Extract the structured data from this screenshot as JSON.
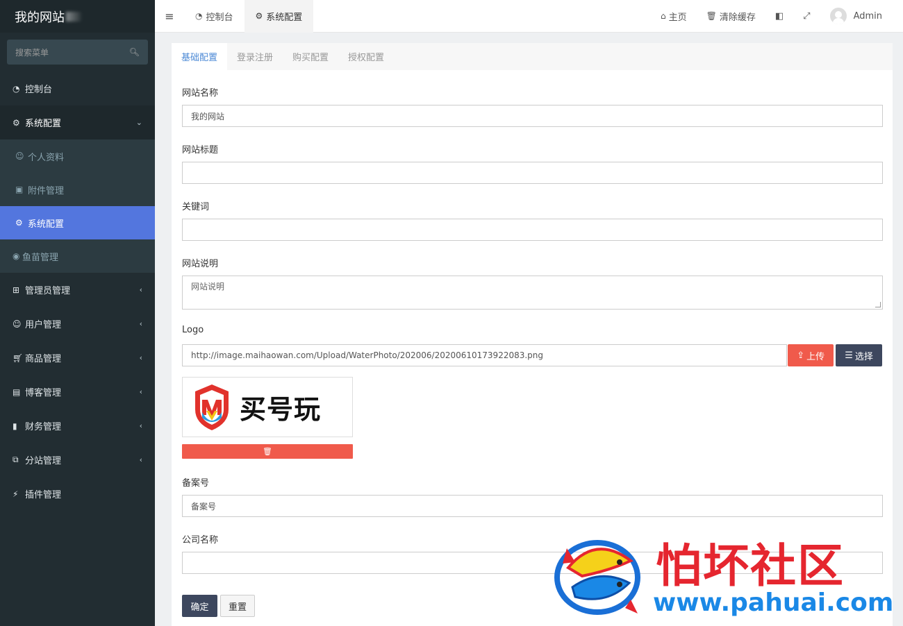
{
  "sidebar": {
    "brand": "我的网站",
    "search_placeholder": "搜索菜单",
    "items": [
      {
        "label": "控制台",
        "icon": "dashboard-icon"
      },
      {
        "label": "系统配置",
        "icon": "cogs-icon"
      },
      {
        "label": "个人资料",
        "icon": "user-icon"
      },
      {
        "label": "附件管理",
        "icon": "image-file-icon"
      },
      {
        "label": "系统配置",
        "icon": "gear-icon"
      },
      {
        "label": "鱼苗管理",
        "icon": "eye-icon"
      },
      {
        "label": "管理员管理",
        "icon": "windows-icon"
      },
      {
        "label": "用户管理",
        "icon": "user-icon"
      },
      {
        "label": "商品管理",
        "icon": "cart-icon"
      },
      {
        "label": "博客管理",
        "icon": "book-icon"
      },
      {
        "label": "财务管理",
        "icon": "bookmark-icon"
      },
      {
        "label": "分站管理",
        "icon": "clone-icon"
      },
      {
        "label": "插件管理",
        "icon": "plug-icon"
      }
    ]
  },
  "topbar": {
    "tabs": [
      {
        "label": "控制台",
        "icon": "dashboard-icon"
      },
      {
        "label": "系统配置",
        "icon": "gear-icon"
      }
    ],
    "home_label": "主页",
    "clear_cache_label": "清除缓存",
    "user_name": "Admin"
  },
  "content": {
    "tabs": [
      "基础配置",
      "登录注册",
      "购买配置",
      "授权配置"
    ],
    "fields": {
      "site_name_label": "网站名称",
      "site_name_value": "我的网站",
      "site_title_label": "网站标题",
      "keywords_label": "关键词",
      "description_label": "网站说明",
      "description_placeholder": "网站说明",
      "logo_label": "Logo",
      "logo_url": "http://image.maihaowan.com/Upload/WaterPhoto/202006/20200610173922083.png",
      "upload_label": "上传",
      "select_label": "选择",
      "logo_text": "买号玩",
      "icp_label": "备案号",
      "icp_placeholder": "备案号",
      "company_label": "公司名称"
    },
    "confirm_label": "确定",
    "reset_label": "重置"
  },
  "watermark": {
    "title": "怕坏社区",
    "url": "www.pahuai.com"
  },
  "colors": {
    "sidebar_bg": "#222d32",
    "active_menu": "#5376de",
    "danger": "#f05a4b",
    "dark_button": "#3d475e",
    "tab_active": "#4d8ad6"
  }
}
